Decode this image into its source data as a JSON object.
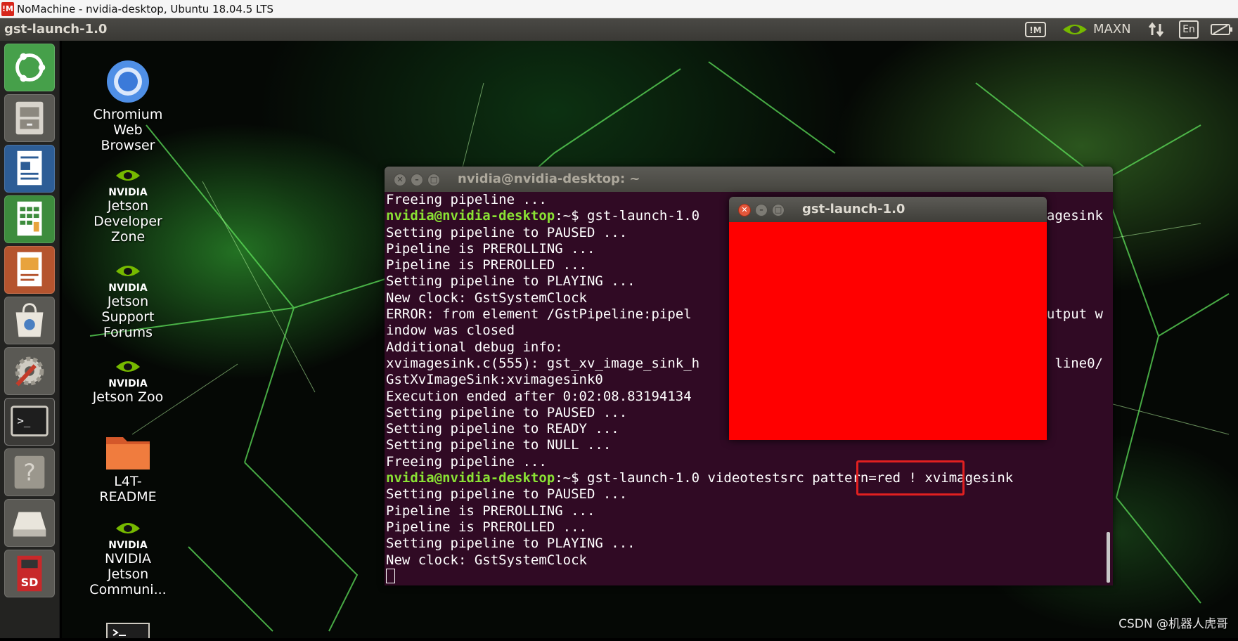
{
  "nomachine": {
    "logo": "!M",
    "title": "NoMachine - nvidia-desktop, Ubuntu 18.04.5 LTS"
  },
  "panel": {
    "app_title": "gst-launch-1.0",
    "tray": {
      "power_mode": "MAXN",
      "keyboard_layout": "En",
      "icons": [
        "nomachine-tray-icon",
        "nvidia-icon",
        "network-icon",
        "keyboard-icon",
        "battery-icon"
      ]
    }
  },
  "launcher": {
    "items": [
      "ubuntu-dash",
      "files",
      "libreoffice-writer",
      "libreoffice-calc",
      "libreoffice-impress",
      "ubuntu-software",
      "system-settings",
      "terminal",
      "help",
      "drive",
      "sd-card"
    ],
    "sd_label": "SD"
  },
  "desktop": {
    "icons": [
      {
        "label": "Chromium\nWeb\nBrowser",
        "lines": [
          "Chromium",
          "Web",
          "Browser"
        ]
      },
      {
        "brand": "NVIDIA",
        "lines": [
          "Jetson",
          "Developer",
          "Zone"
        ]
      },
      {
        "brand": "NVIDIA",
        "lines": [
          "Jetson",
          "Support",
          "Forums"
        ]
      },
      {
        "brand": "NVIDIA",
        "lines": [
          "Jetson Zoo"
        ]
      },
      {
        "lines": [
          "L4T-",
          "README"
        ]
      },
      {
        "brand": "NVIDIA",
        "lines": [
          "NVIDIA",
          "Jetson",
          "Communi..."
        ]
      }
    ]
  },
  "terminal": {
    "title": "nvidia@nvidia-desktop: ~",
    "prompt": "nvidia@nvidia-desktop",
    "lines": [
      {
        "text": "Freeing pipeline ..."
      },
      {
        "prompt": "nvidia@nvidia-desktop",
        "text": ":~$ gst-launch-1.0",
        "tail": "agesink"
      },
      {
        "text": "Setting pipeline to PAUSED ..."
      },
      {
        "text": "Pipeline is PREROLLING ..."
      },
      {
        "text": "Pipeline is PREROLLED ..."
      },
      {
        "text": "Setting pipeline to PLAYING ..."
      },
      {
        "text": "New clock: GstSystemClock"
      },
      {
        "text": "ERROR: from element /GstPipeline:pipel",
        "tail": "utput w"
      },
      {
        "text": "indow was closed"
      },
      {
        "text": "Additional debug info:"
      },
      {
        "text": "xvimagesink.c(555): gst_xv_image_sink_h",
        "tail": "line0/"
      },
      {
        "text": "GstXvImageSink:xvimagesink0"
      },
      {
        "text": "Execution ended after 0:02:08.83194134"
      },
      {
        "text": "Setting pipeline to PAUSED ..."
      },
      {
        "text": "Setting pipeline to READY ..."
      },
      {
        "text": "Setting pipeline to NULL ..."
      },
      {
        "text": "Freeing pipeline ..."
      },
      {
        "prompt": "nvidia@nvidia-desktop",
        "text": ":~$ gst-launch-1.0 videotestsrc pattern=red ! xvimagesink"
      },
      {
        "text": "Setting pipeline to PAUSED ..."
      },
      {
        "text": "Pipeline is PREROLLING ..."
      },
      {
        "text": "Pipeline is PREROLLED ..."
      },
      {
        "text": "Setting pipeline to PLAYING ..."
      },
      {
        "text": "New clock: GstSystemClock"
      }
    ]
  },
  "gst_window": {
    "title": "gst-launch-1.0",
    "video_color": "#ff0000"
  },
  "watermark": "CSDN @机器人虎哥",
  "colors": {
    "terminal_bg": "#300a24",
    "prompt_green": "#8ae234",
    "highlight_red": "#e02020"
  }
}
